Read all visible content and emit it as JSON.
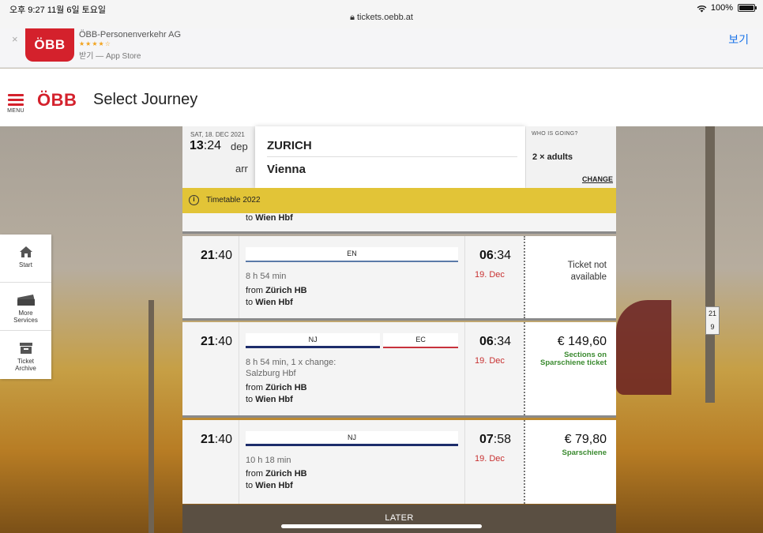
{
  "status_bar": {
    "time": "오후 9:27   11월 6일 토요일",
    "url": "tickets.oebb.at",
    "battery": "100%"
  },
  "app_banner": {
    "close": "×",
    "icon_text": "ÖBB",
    "name": "ÖBB-Personenverkehr AG",
    "stars": "★★★★☆",
    "store": "받기 — App Store",
    "view_label": "보기"
  },
  "header": {
    "menu_label": "MENU",
    "logo": "ÖBB",
    "title": "Select Journey"
  },
  "sidebar": {
    "items": [
      {
        "label": "Start"
      },
      {
        "label": "More\nServices"
      },
      {
        "label": "Ticket\nArchive"
      }
    ]
  },
  "search": {
    "date": "SAT, 18. DEC 2021",
    "dep_hour": "13",
    "dep_min": ":24",
    "dep_label": "dep",
    "arr_label": "arr",
    "from": "ZURICH",
    "to": "Vienna",
    "who_label": "WHO IS GOING?",
    "who_value": "2 × adults",
    "change_label": "CHANGE"
  },
  "notice": {
    "text": "Timetable 2022"
  },
  "partial_row": {
    "to_prefix": "to ",
    "to_station": "Wien Hbf"
  },
  "connections": [
    {
      "dep_hour": "21",
      "dep_min": ":40",
      "trains": [
        "EN"
      ],
      "duration": "8 h 54 min",
      "change": "",
      "from_prefix": "from ",
      "from_station": "Zürich HB",
      "to_prefix": "to ",
      "to_station": "Wien Hbf",
      "arr_hour": "06",
      "arr_min": ":34",
      "arr_date": "19. Dec",
      "price": "",
      "price_note": "",
      "unavailable": "Ticket not available"
    },
    {
      "dep_hour": "21",
      "dep_min": ":40",
      "trains": [
        "NJ",
        "EC"
      ],
      "duration": "8 h 54 min, 1 x change:",
      "change": "Salzburg Hbf",
      "from_prefix": "from ",
      "from_station": "Zürich HB",
      "to_prefix": "to ",
      "to_station": "Wien Hbf",
      "arr_hour": "06",
      "arr_min": ":34",
      "arr_date": "19. Dec",
      "price": "€ 149,60",
      "price_note": "Sections on Sparschiene ticket",
      "unavailable": ""
    },
    {
      "dep_hour": "21",
      "dep_min": ":40",
      "trains": [
        "NJ"
      ],
      "duration": "10 h 18 min",
      "change": "",
      "from_prefix": "from ",
      "from_station": "Zürich HB",
      "to_prefix": "to ",
      "to_station": "Wien Hbf",
      "arr_hour": "07",
      "arr_min": ":58",
      "arr_date": "19. Dec",
      "price": "€ 79,80",
      "price_note": "Sparschiene",
      "unavailable": ""
    }
  ],
  "later_label": "LATER"
}
